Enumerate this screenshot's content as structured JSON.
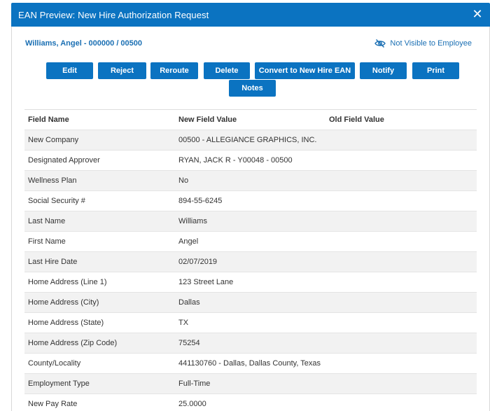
{
  "modal": {
    "title": "EAN Preview: New Hire Authorization Request",
    "close_glyph": "✕"
  },
  "employee": {
    "name_line": "Williams, Angel - 000000 / 00500",
    "visibility_label": "Not Visible to Employee",
    "visibility_icon": "eye-slash-icon"
  },
  "actions": {
    "edit": "Edit",
    "reject": "Reject",
    "reroute": "Reroute",
    "delete": "Delete",
    "convert": "Convert to New Hire EAN",
    "notify": "Notify",
    "print": "Print",
    "notes": "Notes"
  },
  "table": {
    "headers": [
      "Field Name",
      "New Field Value",
      "Old Field Value"
    ],
    "rows": [
      {
        "field": "New Company",
        "new": "00500 - ALLEGIANCE GRAPHICS, INC.",
        "old": ""
      },
      {
        "field": "Designated Approver",
        "new": "RYAN, JACK R - Y00048 - 00500",
        "old": ""
      },
      {
        "field": "Wellness Plan",
        "new": "No",
        "old": ""
      },
      {
        "field": "Social Security #",
        "new": "894-55-6245",
        "old": ""
      },
      {
        "field": "Last Name",
        "new": "Williams",
        "old": ""
      },
      {
        "field": "First Name",
        "new": "Angel",
        "old": ""
      },
      {
        "field": "Last Hire Date",
        "new": "02/07/2019",
        "old": ""
      },
      {
        "field": "Home Address (Line 1)",
        "new": "123 Street Lane",
        "old": ""
      },
      {
        "field": "Home Address (City)",
        "new": "Dallas",
        "old": ""
      },
      {
        "field": "Home Address (State)",
        "new": "TX",
        "old": ""
      },
      {
        "field": "Home Address (Zip Code)",
        "new": "75254",
        "old": ""
      },
      {
        "field": "County/Locality",
        "new": "441130760 - Dallas, Dallas County, Texas",
        "old": ""
      },
      {
        "field": "Employment Type",
        "new": "Full-Time",
        "old": ""
      },
      {
        "field": "New Pay Rate",
        "new": "25.0000",
        "old": ""
      }
    ]
  },
  "colors": {
    "accent": "#0b73c1",
    "link": "#1a6fb3",
    "row_alt": "#f2f2f2"
  }
}
